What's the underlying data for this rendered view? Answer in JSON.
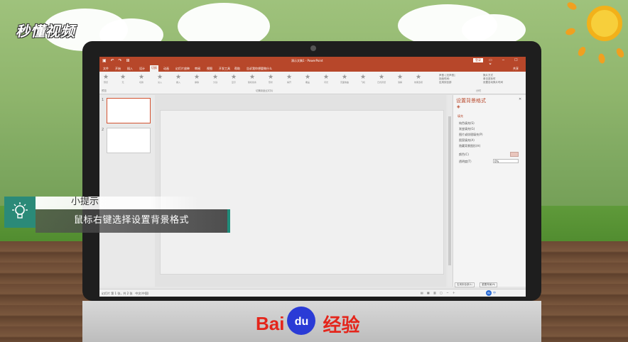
{
  "overlay": {
    "logo_text": "秒懂视频",
    "tip_title": "小提示",
    "tip_text": "鼠标右键选择设置背景格式",
    "brand_latin": "Bai",
    "brand_du": "du",
    "brand_cn": "经验"
  },
  "powerpoint": {
    "doc_title": "演示文稿1 - PowerPoint",
    "login_label": "登录",
    "tabs": [
      "文件",
      "开始",
      "插入",
      "设计",
      "切换",
      "动画",
      "幻灯片放映",
      "审阅",
      "视图",
      "开发工具",
      "帮助",
      "告诉我你想要做什么"
    ],
    "active_tab": "切换",
    "share_label": "共享",
    "effects": [
      "无",
      "切换",
      "淡入",
      "推入",
      "擦除",
      "分割",
      "显示",
      "随机线条",
      "形状",
      "揭开",
      "覆盖",
      "闪光",
      "页面卷曲",
      "飞机",
      "日式折纸",
      "溶解",
      "效果选项"
    ],
    "preview_label": "预览",
    "group_preview": "预览",
    "group_transitions": "切换到此幻灯片",
    "group_timing": "计时",
    "timing": {
      "sound": "声音: [无声音]",
      "duration": "持续时间:",
      "apply_all": "应用到全部",
      "advance": "换片方式",
      "on_click": "单击鼠标时",
      "after": "设置自动换片时间"
    },
    "thumbnails": [
      {
        "num": "1"
      },
      {
        "num": "2"
      }
    ],
    "format_pane": {
      "title": "设置背景格式",
      "section": "填充",
      "options": [
        "纯色填充(S)",
        "渐变填充(G)",
        "图片或纹理填充(P)",
        "图案填充(A)",
        "隐藏背景图形(H)"
      ],
      "color_label": "颜色(C)",
      "transparency_label": "透明度(T)",
      "transparency_value": "0%",
      "apply_all_button": "应用到全部(L)",
      "reset_button": "重置背景(B)"
    },
    "status_left": "幻灯片 第 1 张，共 2 张",
    "status_lang": "中文(中国)",
    "ime_text": "中"
  },
  "colors": {
    "ppt_accent": "#b7472a",
    "tip_teal": "#2b8a78",
    "baidu_red": "#e4251b",
    "baidu_blue": "#2a3bd6"
  }
}
